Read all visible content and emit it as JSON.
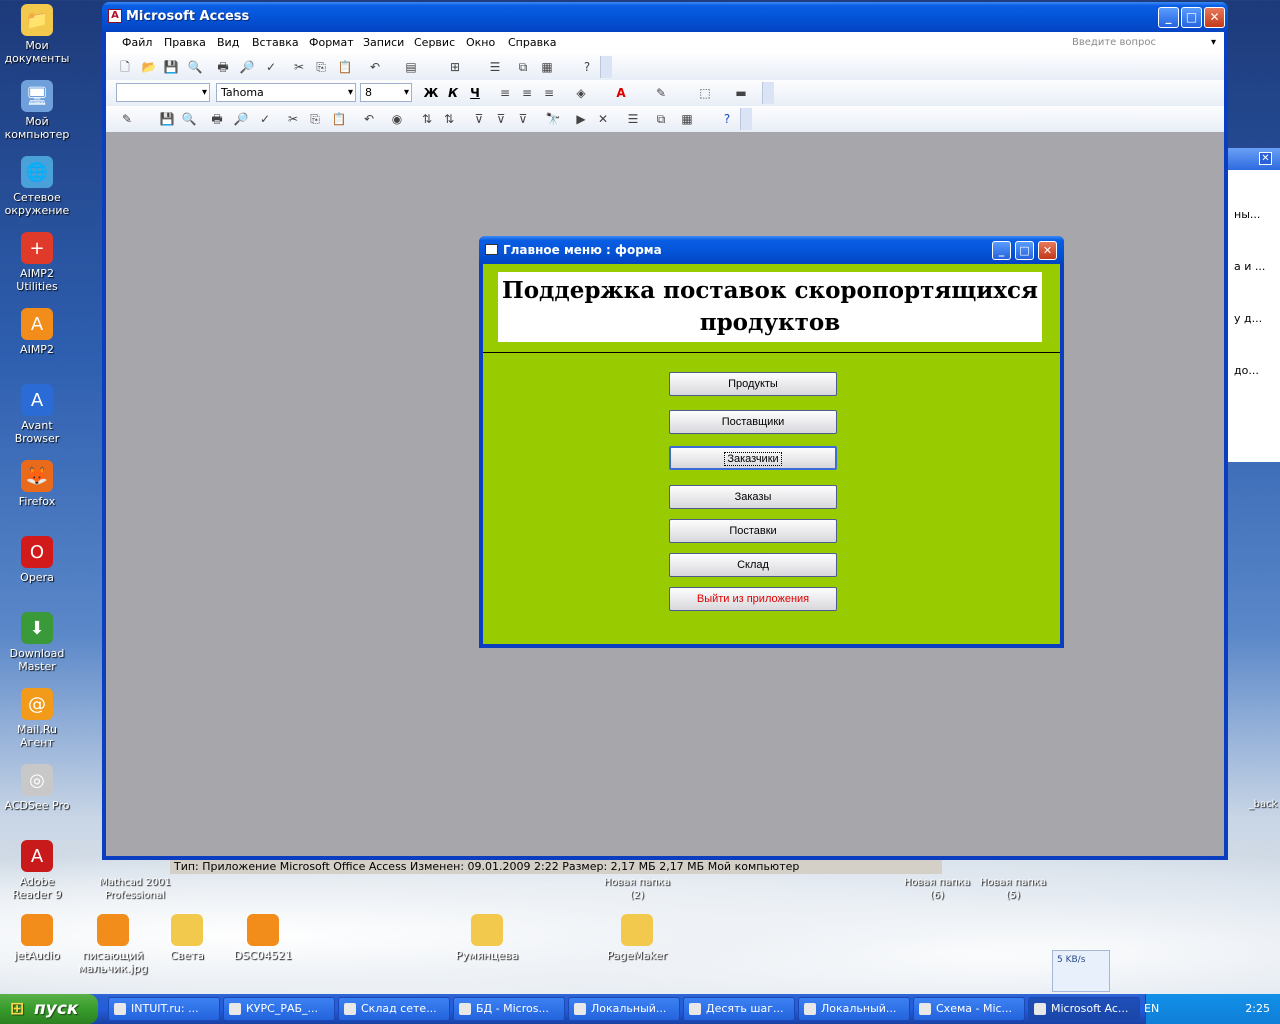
{
  "desktop": {
    "icons": [
      {
        "label": "Мои документы",
        "color": "#f2c94c",
        "glyph": "📁"
      },
      {
        "label": "Мой компьютер",
        "color": "#6fa0dc",
        "glyph": "🖥"
      },
      {
        "label": "Сетевое окружение",
        "color": "#4aa0d8",
        "glyph": "🌐"
      },
      {
        "label": "AIMP2 Utilities",
        "color": "#e03a2a",
        "glyph": "+"
      },
      {
        "label": "AIMP2",
        "color": "#f28c1a",
        "glyph": "A"
      },
      {
        "label": "Avant Browser",
        "color": "#2a6bd6",
        "glyph": "A"
      },
      {
        "label": "Firefox",
        "color": "#e86a1a",
        "glyph": "🦊"
      },
      {
        "label": "Opera",
        "color": "#d21a1a",
        "glyph": "O"
      },
      {
        "label": "Download Master",
        "color": "#3a9a3a",
        "glyph": "⬇"
      },
      {
        "label": "Mail.Ru Агент",
        "color": "#f29a1a",
        "glyph": "@"
      },
      {
        "label": "ACDSee Pro",
        "color": "#c8c8c8",
        "glyph": "◎"
      },
      {
        "label": "Adobe Reader 9",
        "color": "#c81a1a",
        "glyph": "A"
      }
    ],
    "bottom_icons": [
      {
        "label": "jetAudio"
      },
      {
        "label": "писающий мальчик.jpg"
      },
      {
        "label": "Света"
      },
      {
        "label": "DSC04521"
      },
      {
        "label": "Румянцева"
      },
      {
        "label": "PageMaker"
      }
    ],
    "obscured_labels": [
      "Mathcad 2001 Professional",
      "Новая папка (2)",
      "Новая папка (6)",
      "Новая папка (5)",
      "_back"
    ],
    "status_strip": "Тип: Приложение Microsoft Office Access Изменен: 09.01.2009 2:22 Размер: 2,17 МБ        2,17 МБ        Мой компьютер",
    "net_speed": "5 KB/s"
  },
  "access": {
    "title": "Microsoft Access",
    "menu": [
      "Файл",
      "Правка",
      "Вид",
      "Вставка",
      "Формат",
      "Записи",
      "Сервис",
      "Окно",
      "Справка"
    ],
    "ask_placeholder": "Введите вопрос",
    "font_name": "Tahoma",
    "font_size": "8",
    "bold": "Ж",
    "italic": "К",
    "underline": "Ч"
  },
  "form": {
    "title": "Главное меню : форма",
    "heading": "Поддержка поставок скоропортящихся продуктов",
    "buttons": [
      "Продукты",
      "Поставщики",
      "Заказчики",
      "Заказы",
      "Поставки",
      "Склад",
      "Выйти из приложения"
    ],
    "focused_index": 2
  },
  "right_window": {
    "items": [
      "ны...",
      "а и ...",
      "у д...",
      "до..."
    ]
  },
  "taskbar": {
    "start": "пуск",
    "tasks": [
      "INTUIT.ru: ...",
      "КУРС_РАБ_...",
      "Склад сете...",
      "БД - Micros...",
      "Локальный...",
      "Десять шаг...",
      "Локальный...",
      "Схема - Mic...",
      "Microsoft Ac..."
    ],
    "active_index": 8,
    "lang": "EN",
    "clock": "2:25"
  }
}
